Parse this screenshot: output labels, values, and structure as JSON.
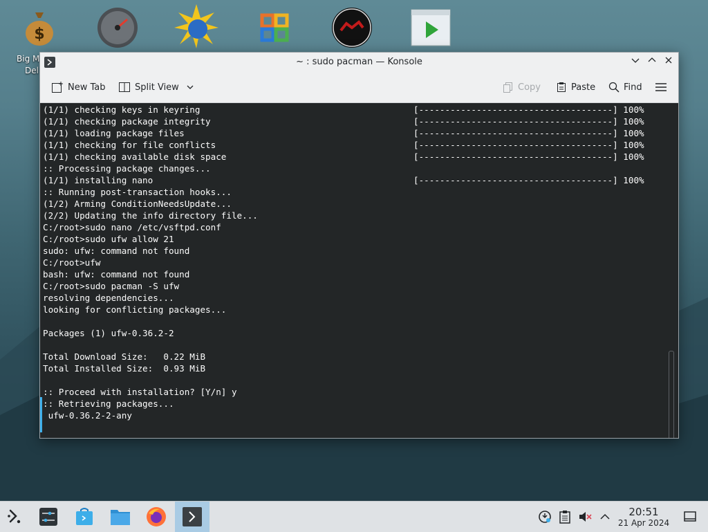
{
  "desktop": {
    "icons": [
      {
        "name": "money-bag-icon",
        "label": "Big M"
      },
      {
        "name": "speedometer-icon",
        "label": ""
      },
      {
        "name": "web-globe-icon",
        "label": ""
      },
      {
        "name": "office-icon",
        "label": ""
      },
      {
        "name": "red-circle-app-icon",
        "label": ""
      },
      {
        "name": "media-player-icon",
        "label": ""
      }
    ],
    "partial_label_2": "Del"
  },
  "window": {
    "title": "~ : sudo pacman — Konsole",
    "toolbar": {
      "new_tab": "New Tab",
      "split_view": "Split View",
      "copy": "Copy",
      "paste": "Paste",
      "find": "Find"
    }
  },
  "terminal": {
    "lines": [
      "(1/1) checking keys in keyring",
      "(1/1) checking package integrity",
      "(1/1) loading package files",
      "(1/1) checking for file conflicts",
      "(1/1) checking available disk space",
      ":: Processing package changes...",
      "(1/1) installing nano",
      ":: Running post-transaction hooks...",
      "(1/2) Arming ConditionNeedsUpdate...",
      "(2/2) Updating the info directory file...",
      "C:/root>sudo nano /etc/vsftpd.conf",
      "C:/root>sudo ufw allow 21",
      "sudo: ufw: command not found",
      "C:/root>ufw",
      "bash: ufw: command not found",
      "C:/root>sudo pacman -S ufw",
      "resolving dependencies...",
      "looking for conflicting packages...",
      "",
      "Packages (1) ufw-0.36.2-2",
      "",
      "Total Download Size:   0.22 MiB",
      "Total Installed Size:  0.93 MiB",
      "",
      ":: Proceed with installation? [Y/n] y",
      ":: Retrieving packages...",
      " ufw-0.36.2-2-any"
    ],
    "progress_lines": [
      "[-------------------------------------] 100%",
      "[-------------------------------------] 100%",
      "[-------------------------------------] 100%",
      "[-------------------------------------] 100%",
      "[-------------------------------------] 100%",
      "",
      "[-------------------------------------] 100%"
    ]
  },
  "taskbar": {
    "time": "20:51",
    "date": "21 Apr 2024",
    "apps": [
      "application-launcher-icon",
      "system-settings-icon",
      "discover-store-icon",
      "file-manager-icon",
      "firefox-icon",
      "konsole-icon"
    ],
    "tray": [
      "network-icon",
      "clipboard-icon",
      "volume-muted-icon",
      "tray-expand-icon",
      "show-desktop-icon"
    ]
  }
}
